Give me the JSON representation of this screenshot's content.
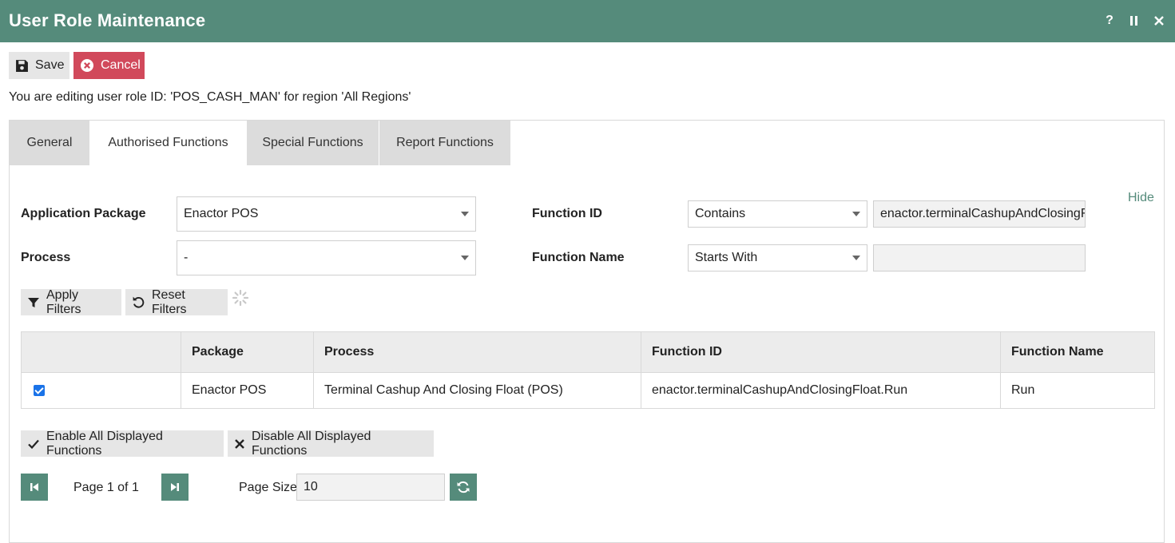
{
  "window": {
    "title": "User Role Maintenance",
    "help_label": "?",
    "pause_label": "⏸",
    "close_label": "✕"
  },
  "toolbar": {
    "save_label": "Save",
    "cancel_label": "Cancel"
  },
  "info_text": "You are editing user role ID: 'POS_CASH_MAN' for region 'All Regions'",
  "tabs": [
    {
      "label": "General"
    },
    {
      "label": "Authorised Functions"
    },
    {
      "label": "Special Functions"
    },
    {
      "label": "Report Functions"
    }
  ],
  "active_tab": "Authorised Functions",
  "filters": {
    "hide_label": "Hide",
    "application_package": {
      "label": "Application Package",
      "value": "Enactor POS"
    },
    "process": {
      "label": "Process",
      "value": "-"
    },
    "function_id": {
      "label": "Function ID",
      "operator": "Contains",
      "value": "enactor.terminalCashupAndClosingFloat.Run"
    },
    "function_name": {
      "label": "Function Name",
      "operator": "Starts With",
      "value": ""
    },
    "apply_label": "Apply Filters",
    "reset_label": "Reset Filters"
  },
  "table": {
    "columns": [
      "",
      "Package",
      "Process",
      "Function ID",
      "Function Name"
    ],
    "rows": [
      {
        "checked": true,
        "package": "Enactor POS",
        "process": "Terminal Cashup And Closing Float (POS)",
        "function_id": "enactor.terminalCashupAndClosingFloat.Run",
        "function_name": "Run"
      }
    ]
  },
  "bulk_actions": {
    "enable_label": "Enable All Displayed Functions",
    "disable_label": "Disable All Displayed Functions"
  },
  "pager": {
    "page_text": "Page 1 of 1",
    "page_size_label": "Page Size",
    "page_size_value": "10"
  },
  "colors": {
    "accent": "#558b7b",
    "cancel": "#d1495b",
    "checkbox": "#1a73e8"
  }
}
